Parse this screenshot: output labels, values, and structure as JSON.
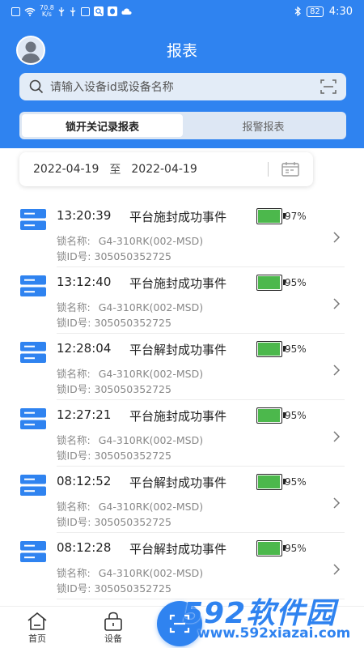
{
  "status_bar": {
    "network_speed_value": "70.8",
    "network_speed_unit": "K/s",
    "battery_level": "82",
    "clock": "4:30"
  },
  "header": {
    "title": "报表",
    "search_placeholder": "请输入设备id或设备名称",
    "tabs": [
      {
        "label": "锁开关记录报表",
        "active": true
      },
      {
        "label": "报警报表",
        "active": false
      }
    ]
  },
  "date_range": {
    "start": "2022-04-19",
    "separator": "至",
    "end": "2022-04-19"
  },
  "records": [
    {
      "time": "13:20:39",
      "event": "平台施封成功事件",
      "battery": 0.97,
      "battery_label": "97%",
      "lock_name_label": "锁名称:",
      "lock_name": "G4-310RK(002-MSD)",
      "lock_id_label": "锁ID号:",
      "lock_id": "305050352725"
    },
    {
      "time": "13:12:40",
      "event": "平台施封成功事件",
      "battery": 0.95,
      "battery_label": "95%",
      "lock_name_label": "锁名称:",
      "lock_name": "G4-310RK(002-MSD)",
      "lock_id_label": "锁ID号:",
      "lock_id": "305050352725"
    },
    {
      "time": "12:28:04",
      "event": "平台解封成功事件",
      "battery": 0.95,
      "battery_label": "95%",
      "lock_name_label": "锁名称:",
      "lock_name": "G4-310RK(002-MSD)",
      "lock_id_label": "锁ID号:",
      "lock_id": "305050352725"
    },
    {
      "time": "12:27:21",
      "event": "平台施封成功事件",
      "battery": 0.95,
      "battery_label": "95%",
      "lock_name_label": "锁名称:",
      "lock_name": "G4-310RK(002-MSD)",
      "lock_id_label": "锁ID号:",
      "lock_id": "305050352725"
    },
    {
      "time": "08:12:52",
      "event": "平台解封成功事件",
      "battery": 0.95,
      "battery_label": "95%",
      "lock_name_label": "锁名称:",
      "lock_name": "G4-310RK(002-MSD)",
      "lock_id_label": "锁ID号:",
      "lock_id": "305050352725"
    },
    {
      "time": "08:12:28",
      "event": "平台解封成功事件",
      "battery": 0.95,
      "battery_label": "95%",
      "lock_name_label": "锁名称:",
      "lock_name": "G4-310RK(002-MSD)",
      "lock_id_label": "锁ID号:",
      "lock_id": "305050352725"
    }
  ],
  "bottom_nav": {
    "home_label": "首页",
    "device_label": "设备"
  },
  "watermark": {
    "digits": "592",
    "text": "软件园",
    "url": "www.592xiazai.com"
  },
  "colors": {
    "primary": "#2f83f0",
    "battery_green": "#4cb84c"
  }
}
